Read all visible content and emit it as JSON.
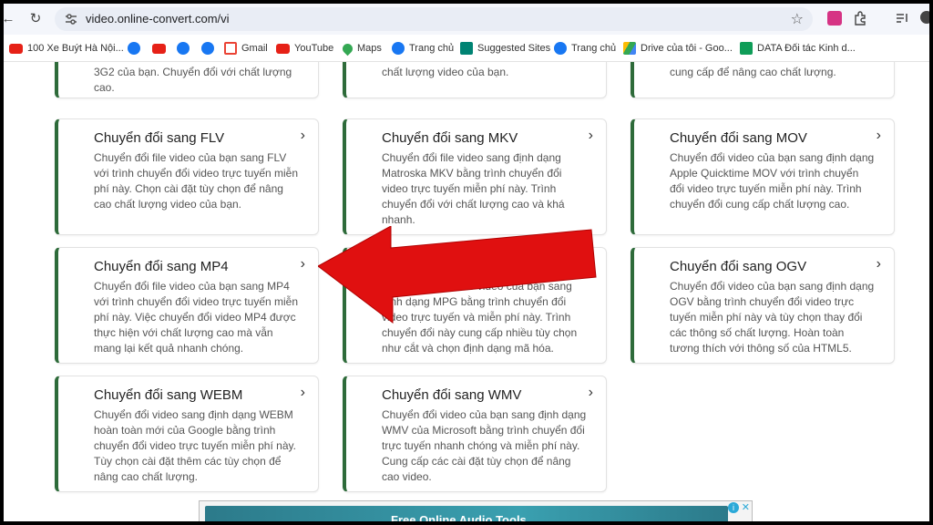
{
  "browser": {
    "url": "video.online-convert.com/vi",
    "bookmarks": [
      {
        "label": "100 Xe Buýt Hà Nội...",
        "icon": "youtube-icon"
      },
      {
        "label": "",
        "icon": "facebook-icon"
      },
      {
        "label": "",
        "icon": "youtube-icon"
      },
      {
        "label": "",
        "icon": "facebook-icon"
      },
      {
        "label": "",
        "icon": "facebook-icon"
      },
      {
        "label": "Gmail",
        "icon": "gmail-icon"
      },
      {
        "label": "YouTube",
        "icon": "youtube-icon"
      },
      {
        "label": "Maps",
        "icon": "maps-icon"
      },
      {
        "label": "Trang chủ",
        "icon": "facebook-icon"
      },
      {
        "label": "Suggested Sites",
        "icon": "bing-icon"
      },
      {
        "label": "Trang chủ",
        "icon": "facebook-icon"
      },
      {
        "label": "Drive của tôi - Goo...",
        "icon": "drive-icon"
      },
      {
        "label": "DATA Đối tác Kinh d...",
        "icon": "sheets-icon"
      }
    ]
  },
  "partial_cards": [
    {
      "desc": "3G2 của bạn. Chuyển đổi với chất lượng cao."
    },
    {
      "desc": "chất lượng video của bạn."
    },
    {
      "desc": "cung cấp để nâng cao chất lượng."
    }
  ],
  "cards": [
    {
      "title": "Chuyển đổi sang FLV",
      "desc": "Chuyển đổi file video của bạn sang FLV với trình chuyển đổi video trực tuyến miễn phí này. Chọn cài đặt tùy chọn để nâng cao chất lượng video của bạn."
    },
    {
      "title": "Chuyển đổi sang MKV",
      "desc": "Chuyển đổi file video sang định dạng Matroska MKV bằng trình chuyển đổi video trực tuyến miễn phí này. Trình chuyển đổi với chất lượng cao và khá nhanh."
    },
    {
      "title": "Chuyển đổi sang MOV",
      "desc": "Chuyển đổi video của bạn sang định dạng Apple Quicktime MOV với trình chuyển đổi video trực tuyến miễn phí này. Trình chuyển đổi cung cấp chất lượng cao."
    },
    {
      "title": "Chuyển đổi sang MP4",
      "desc": "Chuyển đổi file video của bạn sang MP4 với trình chuyển đổi video trực tuyến miễn phí này. Việc chuyển đổi video MP4 được thực hiện với chất lượng cao mà vẫn mang lại kết quả nhanh chóng."
    },
    {
      "title": "",
      "desc": "Chuyển đổi các file video của bạn sang định dạng MPG bằng trình chuyển đổi video trực tuyến và miễn phí này. Trình chuyển đổi này cung cấp nhiều tùy chọn như cắt và chọn định dạng mã hóa."
    },
    {
      "title": "Chuyển đổi sang OGV",
      "desc": "Chuyển đổi video của bạn sang định dạng OGV bằng trình chuyển đổi video trực tuyến miễn phí này và tùy chọn thay đổi các thông số chất lượng. Hoàn toàn tương thích với thông số của HTML5."
    },
    {
      "title": "Chuyển đổi sang WEBM",
      "desc": "Chuyển đổi video sang định dạng WEBM hoàn toàn mới của Google bằng trình chuyển đổi video trực tuyến miễn phí này. Tùy chọn cài đặt thêm các tùy chọn để nâng cao chất lượng."
    },
    {
      "title": "Chuyển đổi sang WMV",
      "desc": "Chuyển đổi video của bạn sang định dạng WMV của Microsoft bằng trình chuyển đổi trực tuyến nhanh chóng và miễn phí này. Cung cấp các cài đặt tùy chọn để nâng cao video."
    }
  ],
  "ad": {
    "text": "Free Online Audio Tools"
  },
  "colors": {
    "card_accent": "#2e6b3a",
    "arrow": "#e01010"
  }
}
